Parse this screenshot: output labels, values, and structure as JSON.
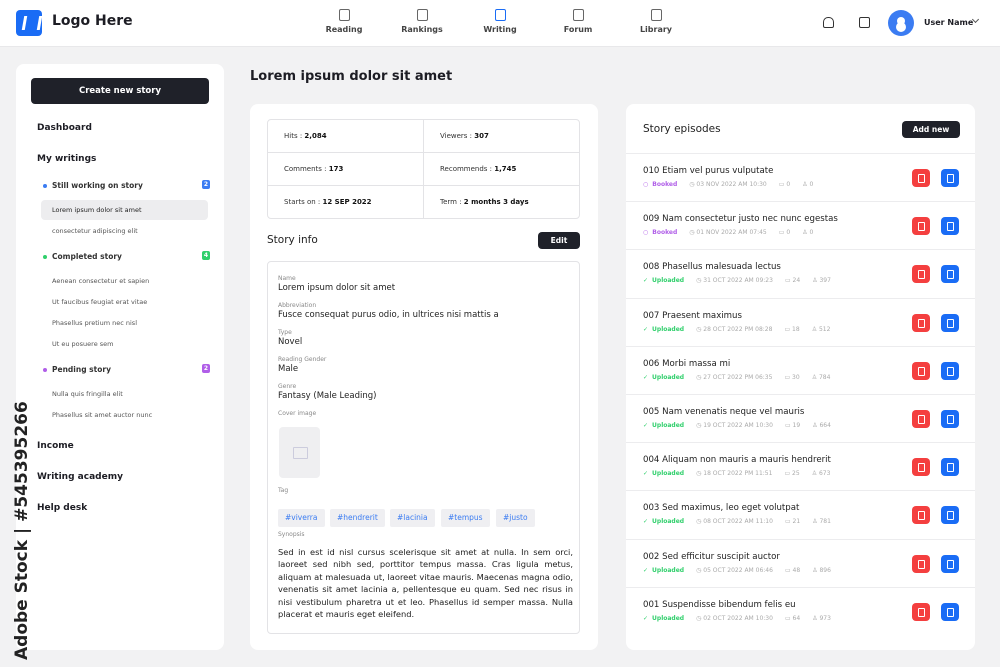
{
  "header": {
    "logo": "Logo Here",
    "nav": [
      {
        "label": "Reading",
        "icon": "book-icon"
      },
      {
        "label": "Rankings",
        "icon": "medal-icon"
      },
      {
        "label": "Writing",
        "icon": "pen-icon",
        "active": true
      },
      {
        "label": "Forum",
        "icon": "forum-icon"
      },
      {
        "label": "Library",
        "icon": "folder-icon"
      }
    ],
    "user": "User Name"
  },
  "sidebar": {
    "create": "Create new story",
    "dashboard": "Dashboard",
    "my_writings": "My writings",
    "groups": [
      {
        "label": "Still working on story",
        "count": "2",
        "color": "#3b7cf2",
        "items": [
          "Lorem ipsum dolor sit amet",
          "consectetur adipiscing elit"
        ]
      },
      {
        "label": "Completed story",
        "count": "4",
        "color": "#2fcf6b",
        "items": [
          "Aenean consectetur et sapien",
          "Ut faucibus feugiat erat vitae",
          "Phasellus pretium nec nisl",
          "Ut eu posuere sem"
        ]
      },
      {
        "label": "Pending story",
        "count": "2",
        "color": "#b05ee8",
        "items": [
          "Nulla quis fringilla elit",
          "Phasellus sit amet auctor nunc"
        ]
      }
    ],
    "income": "Income",
    "academy": "Writing academy",
    "help": "Help desk"
  },
  "page_title": "Lorem ipsum dolor sit amet",
  "stats": [
    {
      "k": "Hits : ",
      "v": "2,084"
    },
    {
      "k": "Viewers : ",
      "v": "307"
    },
    {
      "k": "Comments : ",
      "v": "173"
    },
    {
      "k": "Recommends : ",
      "v": "1,745"
    },
    {
      "k": "Starts on : ",
      "v": "12 SEP 2022"
    },
    {
      "k": "Term : ",
      "v": "2 months 3 days"
    }
  ],
  "story_info": {
    "title": "Story info",
    "edit": "Edit",
    "name_l": "Name",
    "name": "Lorem ipsum dolor sit amet",
    "abbr_l": "Abbreviation",
    "abbr": "Fusce consequat purus odio, in ultrices nisi mattis a",
    "type_l": "Type",
    "type": "Novel",
    "gender_l": "Reading Gender",
    "gender": "Male",
    "genre_l": "Genre",
    "genre": "Fantasy (Male Leading)",
    "cover_l": "Cover image",
    "tag_l": "Tag",
    "tags": [
      "#viverra",
      "#hendrerit",
      "#lacinia",
      "#tempus",
      "#justo"
    ],
    "syn_l": "Synopsis",
    "synopsis": "Sed in est id nisl cursus scelerisque sit amet at nulla. In sem orci, laoreet sed nibh sed, porttitor tempus massa. Cras ligula metus, aliquam at malesuada ut, laoreet vitae mauris. Maecenas magna odio, venenatis sit amet lacinia a, pellentesque eu quam. Sed nec risus in nisi vestibulum pharetra ut et leo. Phasellus id semper massa. Nulla placerat et mauris eget eleifend."
  },
  "episodes": {
    "title": "Story episodes",
    "add": "Add new",
    "colors": {
      "booked": "#b05ee8",
      "uploaded": "#2fcf6b",
      "delete": "#f43f3f",
      "edit": "#1a6cf5"
    },
    "items": [
      {
        "title": "010  Etiam vel purus vulputate",
        "status": "Booked",
        "date": "03 NOV 2022 AM 10:30",
        "comments": "0",
        "views": "0"
      },
      {
        "title": "009 Nam consectetur justo nec nunc egestas",
        "status": "Booked",
        "date": "01 NOV 2022 AM 07:45",
        "comments": "0",
        "views": "0"
      },
      {
        "title": "008 Phasellus malesuada lectus",
        "status": "Uploaded",
        "date": "31 OCT 2022 AM 09:23",
        "comments": "24",
        "views": "397"
      },
      {
        "title": "007 Praesent maximus",
        "status": "Uploaded",
        "date": "28 OCT 2022 PM 08:28",
        "comments": "18",
        "views": "512"
      },
      {
        "title": "006 Morbi massa mi",
        "status": "Uploaded",
        "date": "27 OCT 2022 PM 06:35",
        "comments": "30",
        "views": "784"
      },
      {
        "title": "005 Nam venenatis neque vel mauris",
        "status": "Uploaded",
        "date": "19 OCT 2022 AM 10:30",
        "comments": "19",
        "views": "664"
      },
      {
        "title": "004 Aliquam non mauris a mauris hendrerit",
        "status": "Uploaded",
        "date": "18 OCT 2022 PM 11:51",
        "comments": "25",
        "views": "673"
      },
      {
        "title": "003 Sed maximus, leo eget volutpat",
        "status": "Uploaded",
        "date": "08 OCT 2022 AM 11:10",
        "comments": "21",
        "views": "781"
      },
      {
        "title": "002 Sed efficitur suscipit auctor",
        "status": "Uploaded",
        "date": "05 OCT 2022 AM 06:46",
        "comments": "48",
        "views": "896"
      },
      {
        "title": "001  Suspendisse bibendum felis eu",
        "status": "Uploaded",
        "date": "02 OCT 2022 AM 10:30",
        "comments": "64",
        "views": "973"
      }
    ]
  },
  "watermark": "Adobe Stock | #545395266"
}
